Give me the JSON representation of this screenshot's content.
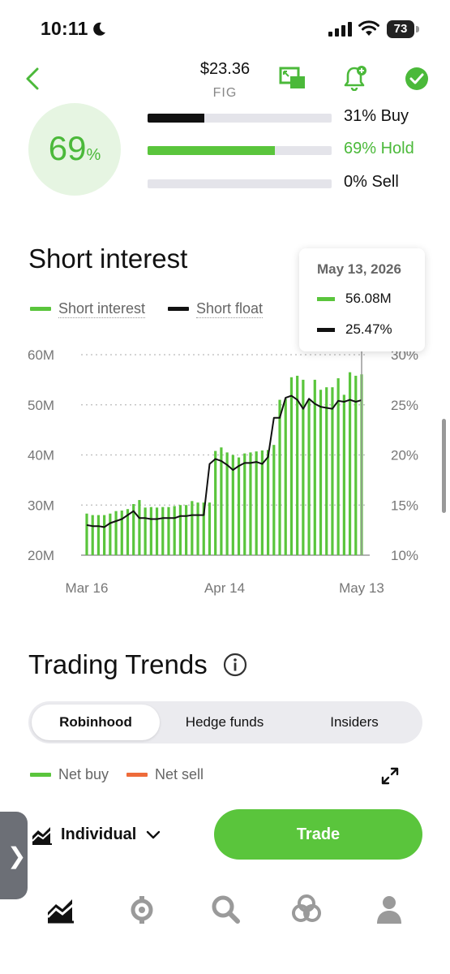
{
  "status_bar": {
    "time": "10:11",
    "battery": "73",
    "icons": [
      "moon-icon",
      "signal-icon",
      "wifi-icon",
      "battery-icon"
    ]
  },
  "header": {
    "price": "$23.36",
    "ticker": "FIG",
    "icons": [
      "back-icon",
      "pip-icon",
      "bell-add-icon",
      "check-circle-icon"
    ]
  },
  "analyst_ratings": {
    "overall_value": "69",
    "overall_unit": "%",
    "rows": [
      {
        "label": "31% Buy",
        "fraction": 0.31,
        "color": "#111111"
      },
      {
        "label": "69% Hold",
        "fraction": 0.69,
        "color": "#5ac53c"
      },
      {
        "label": "0% Sell",
        "fraction": 0.0,
        "color": "#111111"
      }
    ]
  },
  "short_interest": {
    "title": "Short interest",
    "legend": [
      {
        "label": "Short interest",
        "color": "#5ac53c"
      },
      {
        "label": "Short float",
        "color": "#111111"
      }
    ],
    "tooltip": {
      "date": "May 13, 2026",
      "short_interest": "56.08M",
      "short_float": "25.47%"
    }
  },
  "chart_data": {
    "type": "bar",
    "x_tick_labels": [
      "Mar 16",
      "Apr 14",
      "May 13"
    ],
    "left_axis": {
      "ticks": [
        "60M",
        "50M",
        "40M",
        "30M",
        "20M"
      ],
      "range": [
        20,
        60
      ],
      "unit": "M"
    },
    "right_axis": {
      "ticks": [
        "30%",
        "25%",
        "20%",
        "15%",
        "10%"
      ],
      "range": [
        10,
        30
      ],
      "unit": "%"
    },
    "grid": "dotted horizontal",
    "series": [
      {
        "name": "Short interest",
        "type": "bar",
        "axis": "left",
        "color": "#5ac53c",
        "values": [
          28.3,
          28.0,
          28.0,
          28.0,
          28.3,
          28.8,
          28.9,
          29.2,
          30.2,
          31.0,
          29.5,
          29.6,
          29.5,
          29.6,
          29.6,
          29.8,
          30.0,
          30.0,
          30.8,
          30.5,
          30.5,
          30.5,
          40.8,
          41.5,
          40.5,
          40.0,
          39.5,
          40.3,
          40.5,
          40.7,
          40.9,
          41.0,
          42.0,
          51.0,
          51.2,
          55.5,
          55.8,
          55.0,
          51.0,
          55.0,
          53.0,
          53.5,
          53.5,
          55.3,
          52.0,
          56.5,
          55.8,
          56.08
        ]
      },
      {
        "name": "Short float",
        "type": "line",
        "axis": "right",
        "color": "#111111",
        "values": [
          13.0,
          12.9,
          12.9,
          12.8,
          13.2,
          13.4,
          13.6,
          14.0,
          14.4,
          13.7,
          13.7,
          13.6,
          13.6,
          13.7,
          13.7,
          13.7,
          13.9,
          13.9,
          14.0,
          14.0,
          14.0,
          19.1,
          19.6,
          19.4,
          19.0,
          18.5,
          18.9,
          19.2,
          19.2,
          19.3,
          19.1,
          19.8,
          23.7,
          23.7,
          25.7,
          25.9,
          25.5,
          24.6,
          25.6,
          25.1,
          24.8,
          24.7,
          24.6,
          25.4,
          25.3,
          25.5,
          25.3,
          25.47
        ]
      }
    ]
  },
  "trading_trends": {
    "title": "Trading Trends",
    "tabs": [
      "Robinhood",
      "Hedge funds",
      "Insiders"
    ],
    "active_tab": "Robinhood",
    "legend": [
      {
        "label": "Net buy",
        "color": "#5ac53c"
      },
      {
        "label": "Net sell",
        "color": "#ee6b3a"
      }
    ]
  },
  "footer": {
    "account_label": "Individual",
    "trade_label": "Trade",
    "side_handle": "❯"
  },
  "bottom_nav": {
    "items": [
      "investing-icon",
      "crypto-icon",
      "search-icon",
      "network-icon",
      "account-icon"
    ]
  }
}
